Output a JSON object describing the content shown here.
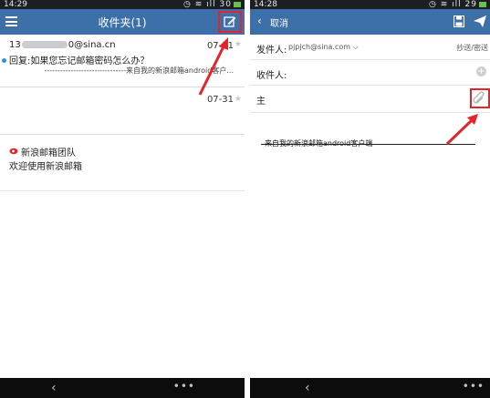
{
  "inbox": {
    "status": {
      "time": "14:29",
      "icons": "◷ ≋ ıll",
      "battery": "30"
    },
    "title": "收件夹(1)",
    "mails": [
      {
        "sender_prefix": "13",
        "sender_suffix": "0@sina.cn",
        "date": "07-31",
        "subject": "回复:如果您忘记邮箱密码怎么办？",
        "preview": "-------------------------------来自我的新浪邮箱android客户..."
      },
      {
        "date": "07-31"
      },
      {
        "sender": "新浪邮箱团队",
        "subject": "欢迎使用新浪邮箱"
      }
    ],
    "nav": {
      "back": "‹",
      "more": "•••"
    }
  },
  "compose": {
    "status": {
      "time": "14:28",
      "icons": "◷ ≋ ıll",
      "battery": "29"
    },
    "cancel": "取消",
    "from_label": "发件人:",
    "from_address": "pjpjch@sina.com",
    "cc_bcc": "抄送/密送",
    "to_label": "收件人:",
    "subject_label": "主",
    "body": "来自我的新浪邮箱android客户端",
    "nav": {
      "back": "‹",
      "more": "•••"
    }
  },
  "colors": {
    "header": "#3d6fa8",
    "highlight": "#e4232a",
    "unread": "#3d8fd1"
  },
  "icons": [
    "menu-icon",
    "compose-icon",
    "back-chevron-icon",
    "save-draft-icon",
    "send-icon",
    "attachment-icon",
    "add-recipient-icon",
    "sina-logo-icon"
  ]
}
